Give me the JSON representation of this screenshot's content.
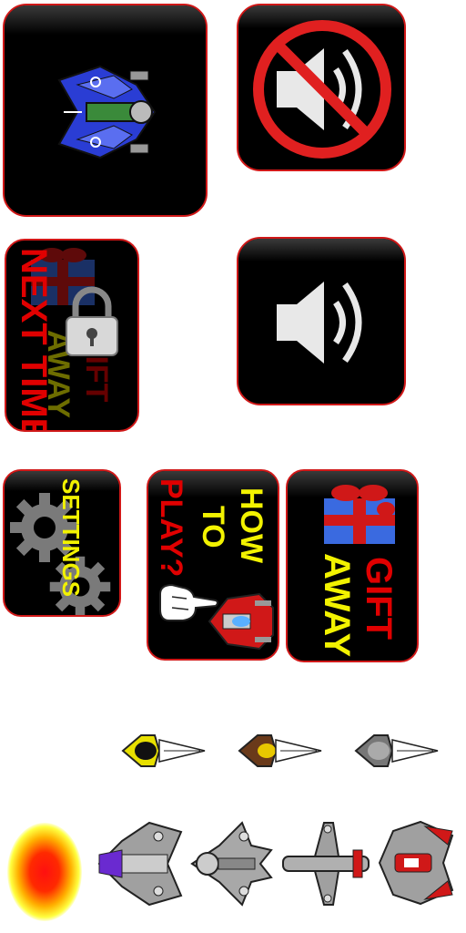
{
  "tiles": {
    "locked_gift": {
      "next_time": "NEXT TIME",
      "gift": "GIFT",
      "away": "AWAY"
    },
    "settings": {
      "label": "SETTINGS"
    },
    "how_to_play": {
      "line1": "HOW",
      "line2": "TO",
      "line3": "PLAY?"
    },
    "gift_away": {
      "gift": "GIFT",
      "away": "AWAY"
    }
  },
  "colors": {
    "tile_border": "#d01818",
    "tile_fill": "#000000",
    "text_yellow": "#f2f200",
    "text_red": "#e00000"
  },
  "icons": [
    "player-ship-icon",
    "sound-off-icon",
    "sound-on-icon",
    "lock-icon",
    "gear-icon",
    "gift-icon",
    "pointing-hand-icon",
    "red-fighter-icon",
    "bee-enemy-icon",
    "explosion-sprite",
    "gray-fighter-icon"
  ]
}
